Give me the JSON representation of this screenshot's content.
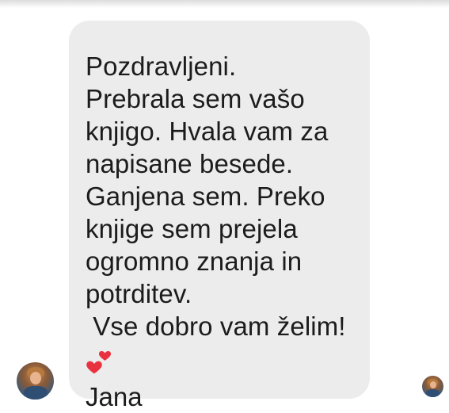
{
  "message": {
    "lines": [
      "Pozdravljeni.",
      "Prebrala sem vašo",
      "knjigo. Hvala vam za",
      "napisane besede.",
      "Ganjena sem. Preko",
      "knjige sem prejela",
      "ogromno znanja in",
      "potrditev.",
      " Vse dobro vam želim!"
    ],
    "emoji": "two-hearts-icon",
    "signature": "Jana",
    "bubble_color": "#ececec",
    "text_color": "#1c1c1c",
    "heart_color": "#e8323f"
  }
}
